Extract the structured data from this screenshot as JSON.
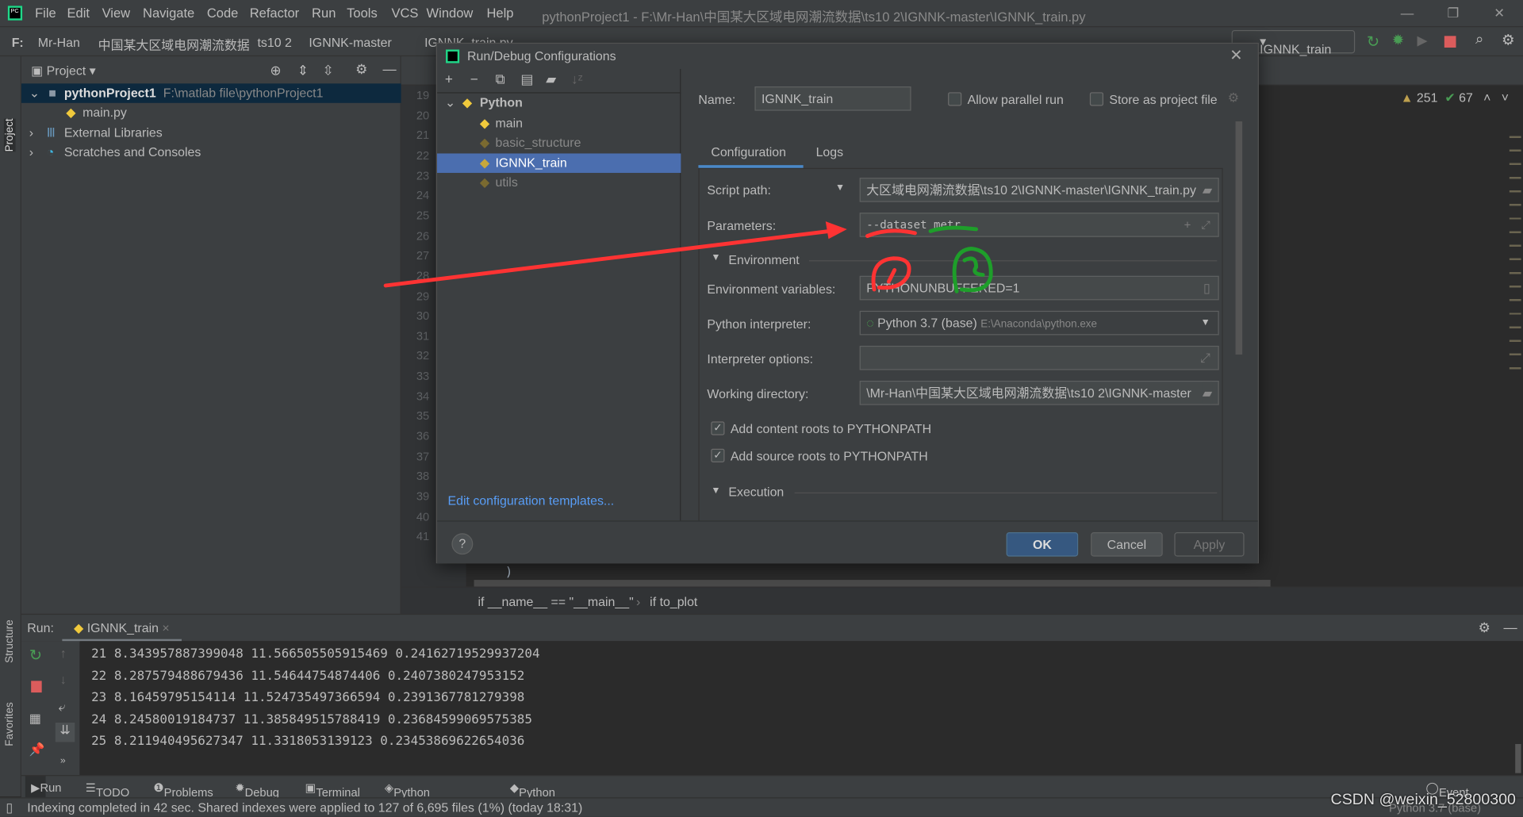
{
  "window": {
    "title": "pythonProject1 - F:\\Mr-Han\\中国某大区域电网潮流数据\\ts10 2\\IGNNK-master\\IGNNK_train.py"
  },
  "menu": [
    "File",
    "Edit",
    "View",
    "Navigate",
    "Code",
    "Refactor",
    "Run",
    "Tools",
    "VCS",
    "Window",
    "Help"
  ],
  "breadcrumb": [
    "F:",
    "Mr-Han",
    "中国某大区域电网潮流数据",
    "ts10 2",
    "IGNNK-master",
    "IGNNK_train.py"
  ],
  "toolbar": {
    "run_config": "IGNNK_train",
    "warnings": "251",
    "weak_warnings": "67"
  },
  "sidestripe": {
    "project": "Project",
    "structure": "Structure",
    "favorites": "Favorites"
  },
  "project_panel": {
    "title": "Project",
    "root": "pythonProject1",
    "root_path": "F:\\matlab file\\pythonProject1",
    "items": [
      "main.py",
      "External Libraries",
      "Scratches and Consoles"
    ]
  },
  "editor": {
    "line_numbers": [
      "19",
      "20",
      "21",
      "22",
      "23",
      "24",
      "25",
      "26",
      "27",
      "28",
      "29",
      "30",
      "31",
      "32",
      "33",
      "34",
      "35",
      "36",
      "37",
      "38",
      "39",
      "40",
      "41"
    ],
    "visible_code": ")",
    "code_breadcrumb": [
      "if __name__ == \"__main__\"",
      "if to_plot"
    ]
  },
  "dialog": {
    "title": "Run/Debug Configurations",
    "tree": {
      "group": "Python",
      "items": [
        "main",
        "basic_structure",
        "IGNNK_train",
        "utils"
      ],
      "selected": "IGNNK_train"
    },
    "edit_templates": "Edit configuration templates...",
    "name_label": "Name:",
    "name_value": "IGNNK_train",
    "allow_parallel": "Allow parallel run",
    "store_project": "Store as project file",
    "tabs": [
      "Configuration",
      "Logs"
    ],
    "script_path_label": "Script path:",
    "script_path": "大区域电网潮流数据\\ts10 2\\IGNNK-master\\IGNNK_train.py",
    "parameters_label": "Parameters:",
    "parameters": "--dataset metr",
    "environment": "Environment",
    "env_vars_label": "Environment variables:",
    "env_vars": "PYTHONUNBUFFERED=1",
    "interpreter_label": "Python interpreter:",
    "interpreter": "Python 3.7 (base)",
    "interpreter_path": "E:\\Anaconda\\python.exe",
    "interp_options_label": "Interpreter options:",
    "interp_options": "",
    "workdir_label": "Working directory:",
    "workdir": "\\Mr-Han\\中国某大区域电网潮流数据\\ts10 2\\IGNNK-master",
    "content_roots": "Add content roots to PYTHONPATH",
    "source_roots": "Add source roots to PYTHONPATH",
    "execution": "Execution",
    "ok": "OK",
    "cancel": "Cancel",
    "apply": "Apply",
    "help": "?"
  },
  "annotations": {
    "circle1": "1",
    "circle2": "2",
    "color_red": "#ff3333",
    "color_green": "#1e9e2a"
  },
  "run_panel": {
    "label": "Run:",
    "tab": "IGNNK_train",
    "lines": [
      "21 8.343957887399048 11.566505505915469 0.24162719529937204",
      "22 8.287579488679436 11.54644754874406 0.2407380247953152",
      "23 8.16459795154114 11.524735497366594 0.2391367781279398",
      "24 8.24580019184737 11.385849515788419 0.23684599069575385",
      "25 8.211940495627347 11.3318053139123 0.23453869622654036"
    ]
  },
  "tool_windows": [
    "Run",
    "TODO",
    "Problems",
    "Debug",
    "Terminal",
    "Python Packages",
    "Python Console"
  ],
  "event_log": "Event Log",
  "status": {
    "message": "Indexing completed in 42 sec. Shared indexes were applied to 127 of 6,695 files (1%) (today 18:31)",
    "interpreter": "Python 3.7 (base)"
  },
  "watermark": "CSDN @weixin_52800300"
}
